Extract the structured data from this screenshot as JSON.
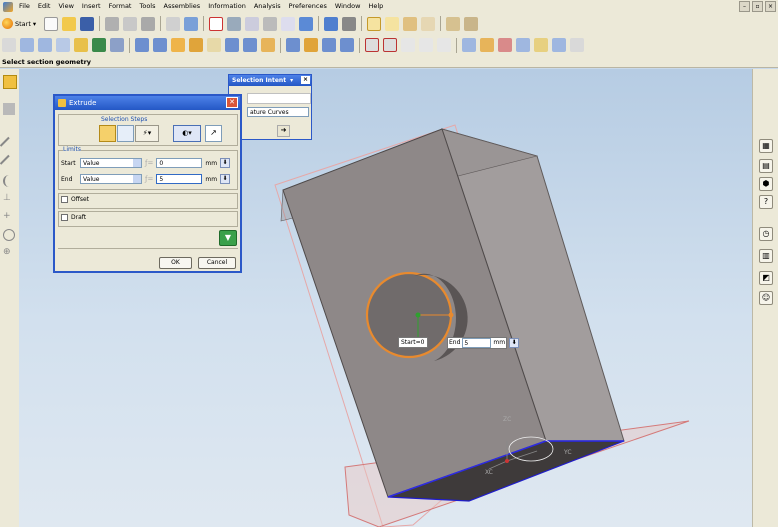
{
  "menu": {
    "items": [
      "File",
      "Edit",
      "View",
      "Insert",
      "Format",
      "Tools",
      "Assemblies",
      "Information",
      "Analysis",
      "Preferences",
      "Window",
      "Help"
    ]
  },
  "toolbar": {
    "start_label": "Start"
  },
  "cue_line": "Select section geometry",
  "extrude_dialog": {
    "title": "Extrude",
    "selection_steps_label": "Selection Steps",
    "limits_label": "Limits",
    "start": {
      "label": "Start",
      "option": "Value",
      "value": "0",
      "unit": "mm"
    },
    "end": {
      "label": "End",
      "option": "Value",
      "value": "5",
      "unit": "mm"
    },
    "offset_label": "Offset",
    "draft_label": "Draft",
    "ok_label": "OK",
    "cancel_label": "Cancel"
  },
  "selection_intent": {
    "title": "Selection Intent",
    "curve_rule": "ature Curves"
  },
  "viewport_labels": {
    "start_tag": "Start=0",
    "end_label": "End",
    "end_value": "5",
    "end_unit": "mm",
    "zc": "ZC",
    "yc": "YC",
    "xc": "XC"
  },
  "colors": {
    "title_bar": "#2457c5",
    "viewport_top": "#b6cce3",
    "section_curve": "#e88a2e",
    "solid_face": "#8c8686"
  }
}
